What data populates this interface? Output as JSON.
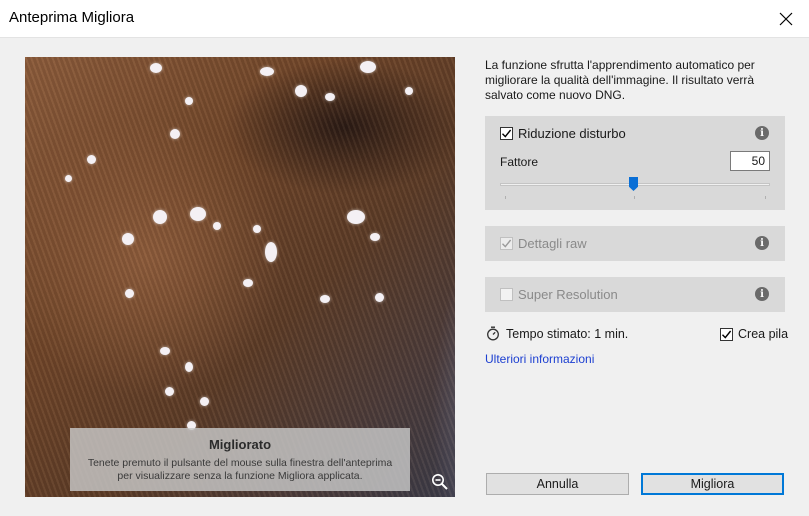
{
  "window": {
    "title": "Anteprima Migliora",
    "close_icon": "close-icon"
  },
  "preview": {
    "overlay_title": "Migliorato",
    "overlay_text_1": "Tenete premuto il pulsante del mouse sulla finestra dell'anteprima",
    "overlay_text_2": "per visualizzare senza la funzione Migliora applicata.",
    "zoom_icon": "zoom-out-icon"
  },
  "description": "La funzione sfrutta l'apprendimento automatico per migliorare la qualità dell'immagine. Il risultato verrà salvato come nuovo DNG.",
  "noise_reduction": {
    "label": "Riduzione disturbo",
    "checked": true,
    "factor_label": "Fattore",
    "factor_value": "50",
    "slider_value": 50,
    "slider_max": 100
  },
  "raw_details": {
    "label": "Dettagli raw",
    "checked": true,
    "disabled": true
  },
  "super_resolution": {
    "label": "Super Resolution",
    "checked": false
  },
  "estimate": {
    "label": "Tempo stimato: 1 min.",
    "icon": "stopwatch-icon"
  },
  "create_stack": {
    "label": "Crea pila",
    "checked": true
  },
  "more_info_link": "Ulteriori informazioni",
  "buttons": {
    "cancel": "Annulla",
    "enhance": "Migliora"
  },
  "colors": {
    "accent": "#0078d7",
    "slider_thumb": "#0a6fd6",
    "link": "#1c3fd1",
    "panel": "#d9d9d9"
  }
}
